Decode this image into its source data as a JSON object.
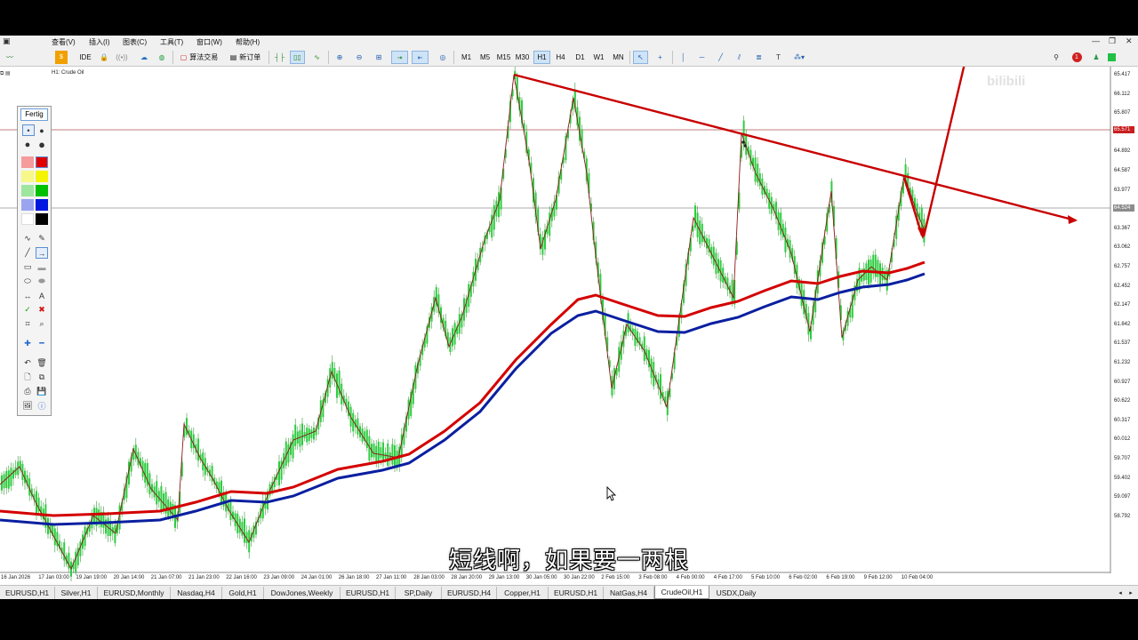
{
  "menu": {
    "items": [
      "查看(V)",
      "插入(I)",
      "图表(C)",
      "工具(T)",
      "窗口(W)",
      "帮助(H)"
    ]
  },
  "toolbar": {
    "ide_label": "IDE",
    "algo_trading_label": "算法交易",
    "new_order_label": "新订单",
    "timeframes": [
      "M1",
      "M5",
      "M15",
      "M30",
      "H1",
      "H4",
      "D1",
      "W1",
      "MN"
    ],
    "active_timeframe": "H1",
    "notification_count": "1"
  },
  "palette": {
    "title": "Fertig"
  },
  "chart": {
    "symbol_label": "H1: Crude Oil",
    "current_price_tag": "65.571",
    "bid_tag": "64.524",
    "y_ticks": [
      "65.417",
      "66.112",
      "65.807",
      "65.197",
      "64.892",
      "64.587",
      "63.977",
      "63.672",
      "63.367",
      "63.062",
      "62.757",
      "62.452",
      "62.147",
      "61.842",
      "61.537",
      "61.232",
      "60.927",
      "60.622",
      "60.317",
      "60.012",
      "59.707",
      "59.402",
      "59.097",
      "58.792"
    ],
    "x_ticks": [
      "16 Jan 2026",
      "17 Jan 03:00",
      "19 Jan 19:00",
      "20 Jan 14:00",
      "21 Jan 07:00",
      "21 Jan 23:00",
      "22 Jan 16:00",
      "23 Jan 09:00",
      "24 Jan 01:00",
      "26 Jan 18:00",
      "27 Jan 11:00",
      "28 Jan 03:00",
      "28 Jan 20:00",
      "29 Jan 13:00",
      "30 Jan 05:00",
      "30 Jan 22:00",
      "2 Feb 15:00",
      "3 Feb 08:00",
      "4 Feb 00:00",
      "4 Feb 17:00",
      "5 Feb 10:00",
      "6 Feb 02:00",
      "6 Feb 19:00",
      "9 Feb 12:00",
      "10 Feb 04:00"
    ],
    "colors": {
      "bull_candle": "#2ecc40",
      "ma_fast": "#d40000",
      "ma_slow": "#0a1fa0",
      "trendline": "#c80000",
      "zigzag": "#8b1a1a"
    }
  },
  "subtitle": "短线啊，如果要一两根",
  "watermark": "bilibili",
  "tabs": [
    {
      "label": "EURUSD,H1"
    },
    {
      "label": "Silver,H1"
    },
    {
      "label": "EURUSD,Monthly"
    },
    {
      "label": "Nasdaq,H4"
    },
    {
      "label": "Gold,H1"
    },
    {
      "label": "DowJones,Weekly"
    },
    {
      "label": "EURUSD,H1"
    },
    {
      "label": "SP,Daily"
    },
    {
      "label": "EURUSD,H4"
    },
    {
      "label": "Copper,H1"
    },
    {
      "label": "EURUSD,H1"
    },
    {
      "label": "NatGas,H4"
    },
    {
      "label": "CrudeOil,H1",
      "active": true
    },
    {
      "label": "USDX,Daily"
    }
  ]
}
